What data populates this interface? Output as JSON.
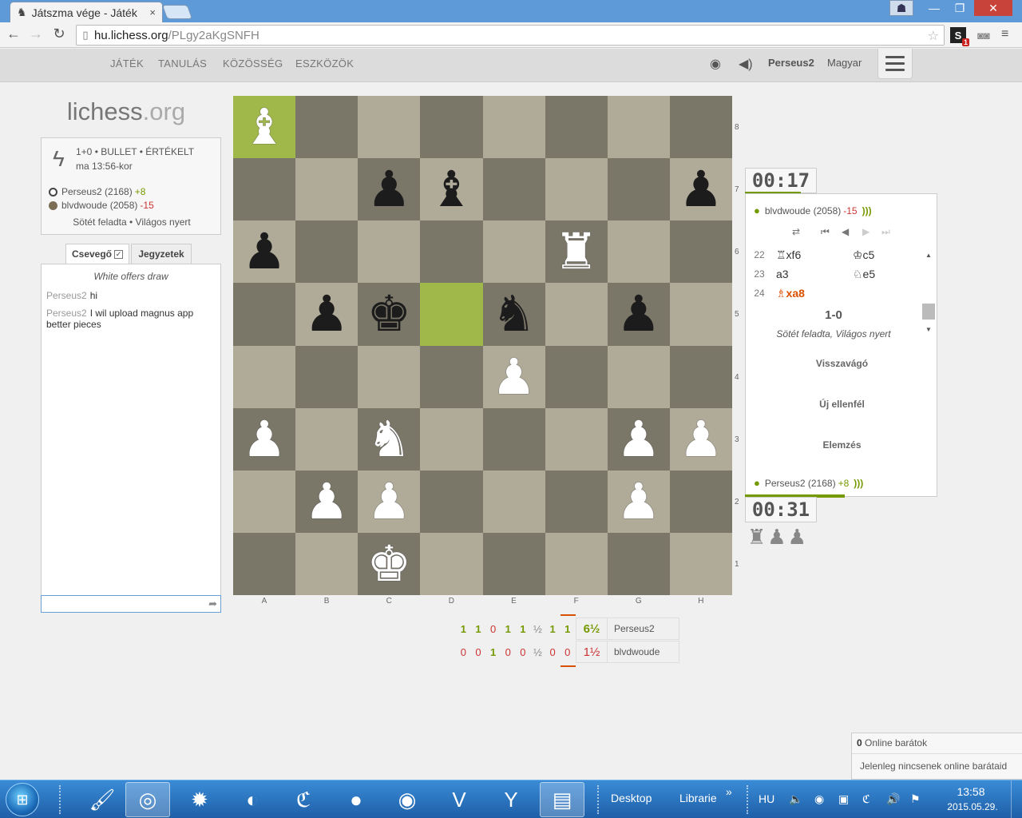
{
  "browser": {
    "tab_title": "Játszma vége - Játék",
    "tab_close": "×",
    "url_host": "hu.lichess.org",
    "url_path": "/PLgy2aKgSNFH"
  },
  "header": {
    "nav": [
      "JÁTÉK",
      "TANULÁS",
      "KÖZÖSSÉG",
      "ESZKÖZÖK"
    ],
    "username": "Perseus2",
    "language": "Magyar"
  },
  "logo": {
    "main": "lichess",
    "suffix": ".org"
  },
  "game_info": {
    "type": "1+0 • BULLET • ÉRTÉKELT",
    "time": "ma 13:56-kor",
    "white": {
      "name": "Perseus2 (2168)",
      "diff": "+8"
    },
    "black": {
      "name": "blvdwoude (2058)",
      "diff": "-15"
    },
    "result": "Sötét feladta • Világos nyert"
  },
  "chat": {
    "tab_chat": "Csevegő",
    "tab_notes": "Jegyzetek",
    "system": "White offers draw",
    "messages": [
      {
        "user": "Perseus2",
        "text": "hi"
      },
      {
        "user": "Perseus2",
        "text": "I wil upload magnus app better pieces"
      }
    ]
  },
  "board": {
    "ranks": [
      "8",
      "7",
      "6",
      "5",
      "4",
      "3",
      "2",
      "1"
    ],
    "files": [
      "A",
      "B",
      "C",
      "D",
      "E",
      "F",
      "G",
      "H"
    ],
    "highlight": [
      "a8",
      "d5"
    ],
    "pieces": {
      "a8": "wB",
      "c7": "bP",
      "d7": "bB",
      "h7": "bP",
      "a6": "bP",
      "f6": "wR",
      "b5": "bP",
      "c5": "bK",
      "e5": "bN",
      "g5": "bP",
      "e4": "wP",
      "a3": "wP",
      "c3": "wN",
      "g3": "wP",
      "h3": "wP",
      "b2": "wP",
      "c2": "wP",
      "g2": "wP",
      "c1": "wK"
    }
  },
  "crosstable": {
    "rows": [
      {
        "scores": [
          "1",
          "1",
          "0",
          "1",
          "1",
          "½",
          "1",
          "1"
        ],
        "total": "6½",
        "name": "Perseus2"
      },
      {
        "scores": [
          "0",
          "0",
          "1",
          "0",
          "0",
          "½",
          "0",
          "0"
        ],
        "total": "1½",
        "name": "blvdwoude"
      }
    ]
  },
  "table": {
    "clock_top": "00:17",
    "clock_bottom": "00:31",
    "top_player": {
      "name": "blvdwoude (2058)",
      "diff": "-15"
    },
    "bottom_player": {
      "name": "Perseus2 (2168)",
      "diff": "+8"
    },
    "moves": [
      {
        "num": "22",
        "white": "♖xf6",
        "black": "♔c5"
      },
      {
        "num": "23",
        "white": "a3",
        "black": "♘e5"
      },
      {
        "num": "24",
        "white": "♗xa8",
        "black": ""
      }
    ],
    "result_score": "1-0",
    "result_text": "Sötét feladta, Világos nyert",
    "actions": [
      "Visszavágó",
      "Új ellenfél",
      "Elemzés"
    ],
    "captured": "♜♟♟"
  },
  "friends": {
    "count": "0",
    "label": "Online barátok",
    "none": "Jelenleg nincsenek online barátaid"
  },
  "taskbar": {
    "desktop": "Desktop",
    "library": "Librarie",
    "lang": "HU",
    "time": "13:58",
    "date": "2015.05.29."
  }
}
